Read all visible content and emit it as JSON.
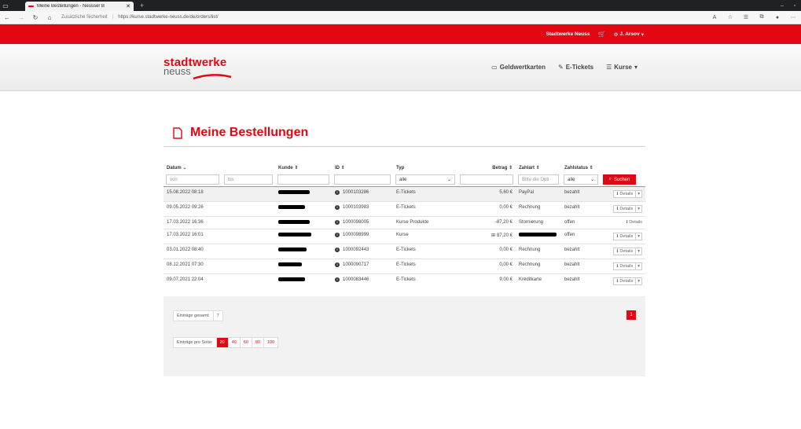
{
  "browser": {
    "tab_title": "Meine Bestellungen - Neusser B",
    "security_label": "Zusätzliche Sicherheit",
    "url": "https://kurse.stadtwerke-neuss.de/de/orders/list/"
  },
  "topbar": {
    "brand_link": "Stadtwerke Neuss",
    "user": "J. Arsov"
  },
  "logo": {
    "line1": "stadtwerke",
    "line2": "neuss"
  },
  "nav": {
    "geldwert": "Geldwertkarten",
    "etickets": "E-Tickets",
    "kurse": "Kurse"
  },
  "page": {
    "title": "Meine Bestellungen"
  },
  "table": {
    "headers": {
      "datum": "Datum",
      "kunde": "Kunde",
      "id": "ID",
      "typ": "Typ",
      "betrag": "Betrag",
      "zahlart": "Zahlart",
      "zahlstatus": "Zahlstatus"
    },
    "filters": {
      "von": "von",
      "bis": "bis",
      "typ": "alle",
      "zahlart": "Bitte die Opti",
      "zahlstatus": "alle",
      "search": "Suchen"
    },
    "rows": [
      {
        "date": "15.08.2022 08:18",
        "id": "1000103286",
        "typ": "E-Tickets",
        "betrag": "5,60 €",
        "zahlart": "PayPal",
        "status": "bezahlt",
        "details": "Details"
      },
      {
        "date": "09.05.2022 09:26",
        "id": "1000103983",
        "typ": "E-Tickets",
        "betrag": "0,00 €",
        "zahlart": "Rechnung",
        "status": "bezahlt",
        "details": "Details"
      },
      {
        "date": "17.03.2022 16:36",
        "id": "1000098005",
        "typ": "Kurse Produkte",
        "betrag": "-87,20 €",
        "zahlart": "Stornierung",
        "status": "offen",
        "details": "Details"
      },
      {
        "date": "17.03.2022 16:01",
        "id": "1000098999",
        "typ": "Kurse",
        "betrag": "87,20 €",
        "zahlart": "",
        "status": "offen",
        "details": "Details"
      },
      {
        "date": "03.01.2022 08:40",
        "id": "1000092443",
        "typ": "E-Tickets",
        "betrag": "0,00 €",
        "zahlart": "Rechnung",
        "status": "bezahlt",
        "details": "Details"
      },
      {
        "date": "08.12.2021 07:30",
        "id": "1000090717",
        "typ": "E-Tickets",
        "betrag": "0,00 €",
        "zahlart": "Rechnung",
        "status": "bezahlt",
        "details": "Details"
      },
      {
        "date": "09.07.2021 22:04",
        "id": "1000083446",
        "typ": "E-Tickets",
        "betrag": "9,00 €",
        "zahlart": "Kreditkarte",
        "status": "bezahlt",
        "details": "Details"
      }
    ]
  },
  "footer": {
    "total_label": "Einträge gesamt:",
    "total_value": "7",
    "page": "1",
    "per_page_label": "Einträge pro Seite:",
    "per_page_options": [
      "20",
      "40",
      "60",
      "80",
      "100"
    ]
  },
  "colors": {
    "brand_red": "#e30613"
  }
}
